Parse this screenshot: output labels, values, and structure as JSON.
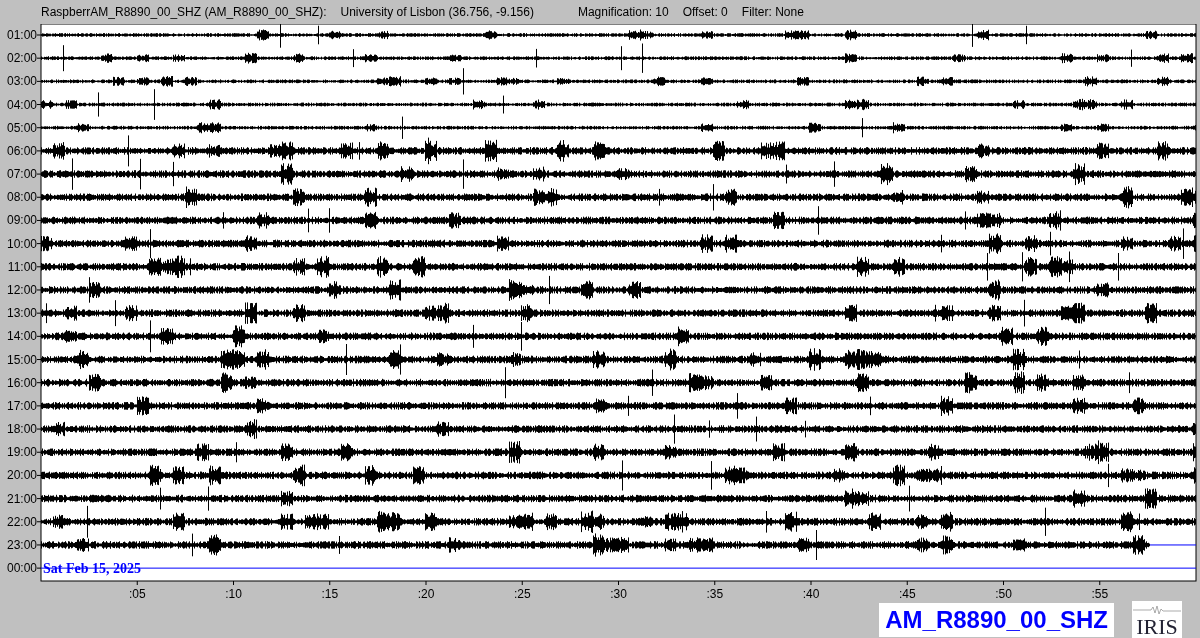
{
  "header": {
    "station": "RaspberrAM_R8890_00_SHZ (AM_R8890_00_SHZ):",
    "location": "University of Lisbon (36.756, -9.156)",
    "magnification": "Magnification: 10",
    "offset": "Offset: 0",
    "filter": "Filter: None"
  },
  "rows": [
    {
      "label": "01:00",
      "kind": "trace"
    },
    {
      "label": "02:00",
      "kind": "trace"
    },
    {
      "label": "03:00",
      "kind": "trace"
    },
    {
      "label": "04:00",
      "kind": "trace"
    },
    {
      "label": "05:00",
      "kind": "trace"
    },
    {
      "label": "06:00",
      "kind": "trace"
    },
    {
      "label": "07:00",
      "kind": "trace"
    },
    {
      "label": "08:00",
      "kind": "trace"
    },
    {
      "label": "09:00",
      "kind": "trace"
    },
    {
      "label": "10:00",
      "kind": "trace"
    },
    {
      "label": "11:00",
      "kind": "trace"
    },
    {
      "label": "12:00",
      "kind": "trace"
    },
    {
      "label": "13:00",
      "kind": "trace"
    },
    {
      "label": "14:00",
      "kind": "trace"
    },
    {
      "label": "15:00",
      "kind": "trace"
    },
    {
      "label": "16:00",
      "kind": "trace"
    },
    {
      "label": "17:00",
      "kind": "trace"
    },
    {
      "label": "18:00",
      "kind": "trace"
    },
    {
      "label": "19:00",
      "kind": "trace"
    },
    {
      "label": "20:00",
      "kind": "trace"
    },
    {
      "label": "21:00",
      "kind": "trace"
    },
    {
      "label": "22:00",
      "kind": "trace"
    },
    {
      "label": "23:00",
      "kind": "partial",
      "level": 0.96
    },
    {
      "label": "00:00",
      "kind": "empty"
    }
  ],
  "date_label": "Sat Feb 15, 2025",
  "x_ticks": [
    ":05",
    ":10",
    ":15",
    ":20",
    ":25",
    ":30",
    ":35",
    ":40",
    ":45",
    ":50",
    ":55"
  ],
  "station_badge": "AM_R8890_00_SHZ",
  "logo": "IRIS"
}
